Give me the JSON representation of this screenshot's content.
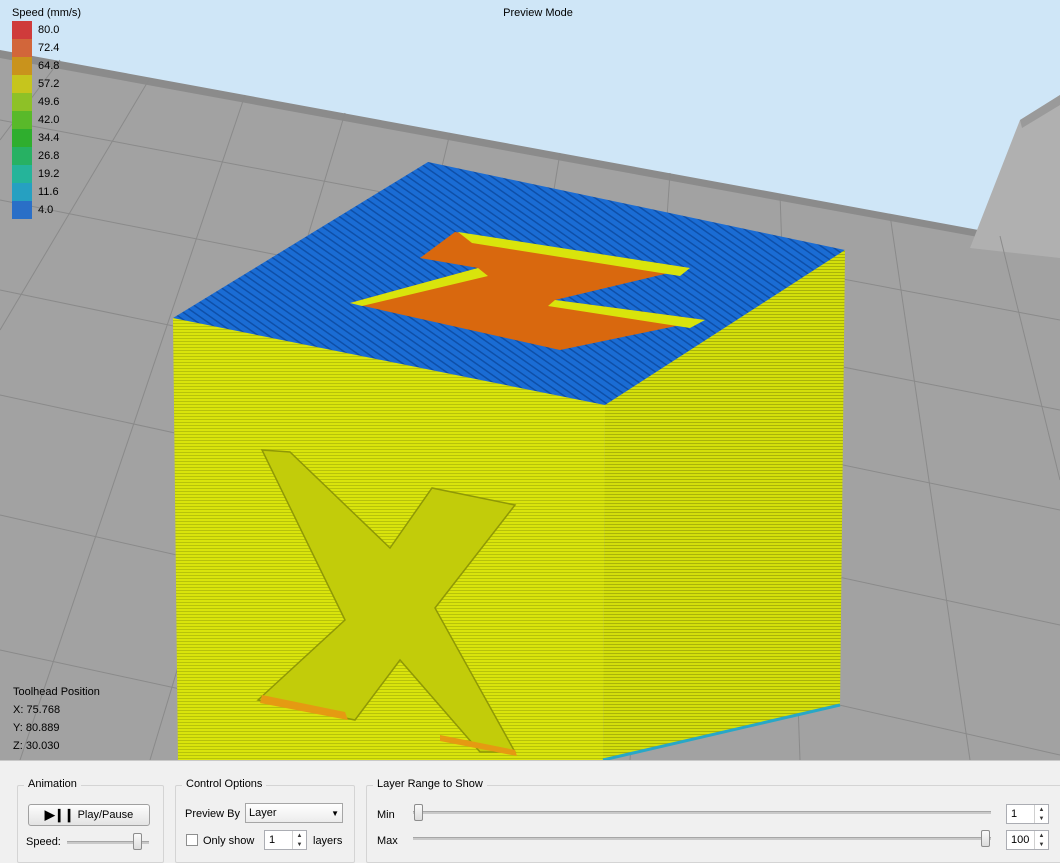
{
  "viewport": {
    "mode_title": "Preview Mode",
    "legend": {
      "title": "Speed (mm/s)",
      "entries": [
        {
          "value": "80.0",
          "color": "#cf3b3b"
        },
        {
          "value": "72.4",
          "color": "#d2663a"
        },
        {
          "value": "64.8",
          "color": "#c9931c"
        },
        {
          "value": "57.2",
          "color": "#c6c51d"
        },
        {
          "value": "49.6",
          "color": "#8ec127"
        },
        {
          "value": "42.0",
          "color": "#59b92a"
        },
        {
          "value": "34.4",
          "color": "#2fae2e"
        },
        {
          "value": "26.8",
          "color": "#27b163"
        },
        {
          "value": "19.2",
          "color": "#25b49a"
        },
        {
          "value": "11.6",
          "color": "#26a0c1"
        },
        {
          "value": "4.0",
          "color": "#2a6fc7"
        }
      ]
    },
    "toolhead": {
      "title": "Toolhead Position",
      "x": "X: 75.768",
      "y": "Y: 80.889",
      "z": "Z: 30.030"
    },
    "colors": {
      "sky": "#cfe6f7",
      "bed": "#a2a2a2",
      "grid": "#8a8a8a",
      "top_blue": "#1869d0",
      "wall_yellow": "#d9e40c",
      "infill_orange": "#d9680e"
    }
  },
  "panel": {
    "animation": {
      "title": "Animation",
      "play_pause_label": "Play/Pause",
      "speed_label": "Speed:",
      "speed_fraction": 0.85
    },
    "control_options": {
      "title": "Control Options",
      "preview_by_label": "Preview By",
      "preview_by_value": "Layer",
      "only_show_label": "Only show",
      "only_show_checked": false,
      "only_show_value": "1",
      "layers_label": "layers"
    },
    "layer_range": {
      "title": "Layer Range to Show",
      "min_label": "Min",
      "min_value": "1",
      "max_label": "Max",
      "max_value": "100"
    }
  }
}
